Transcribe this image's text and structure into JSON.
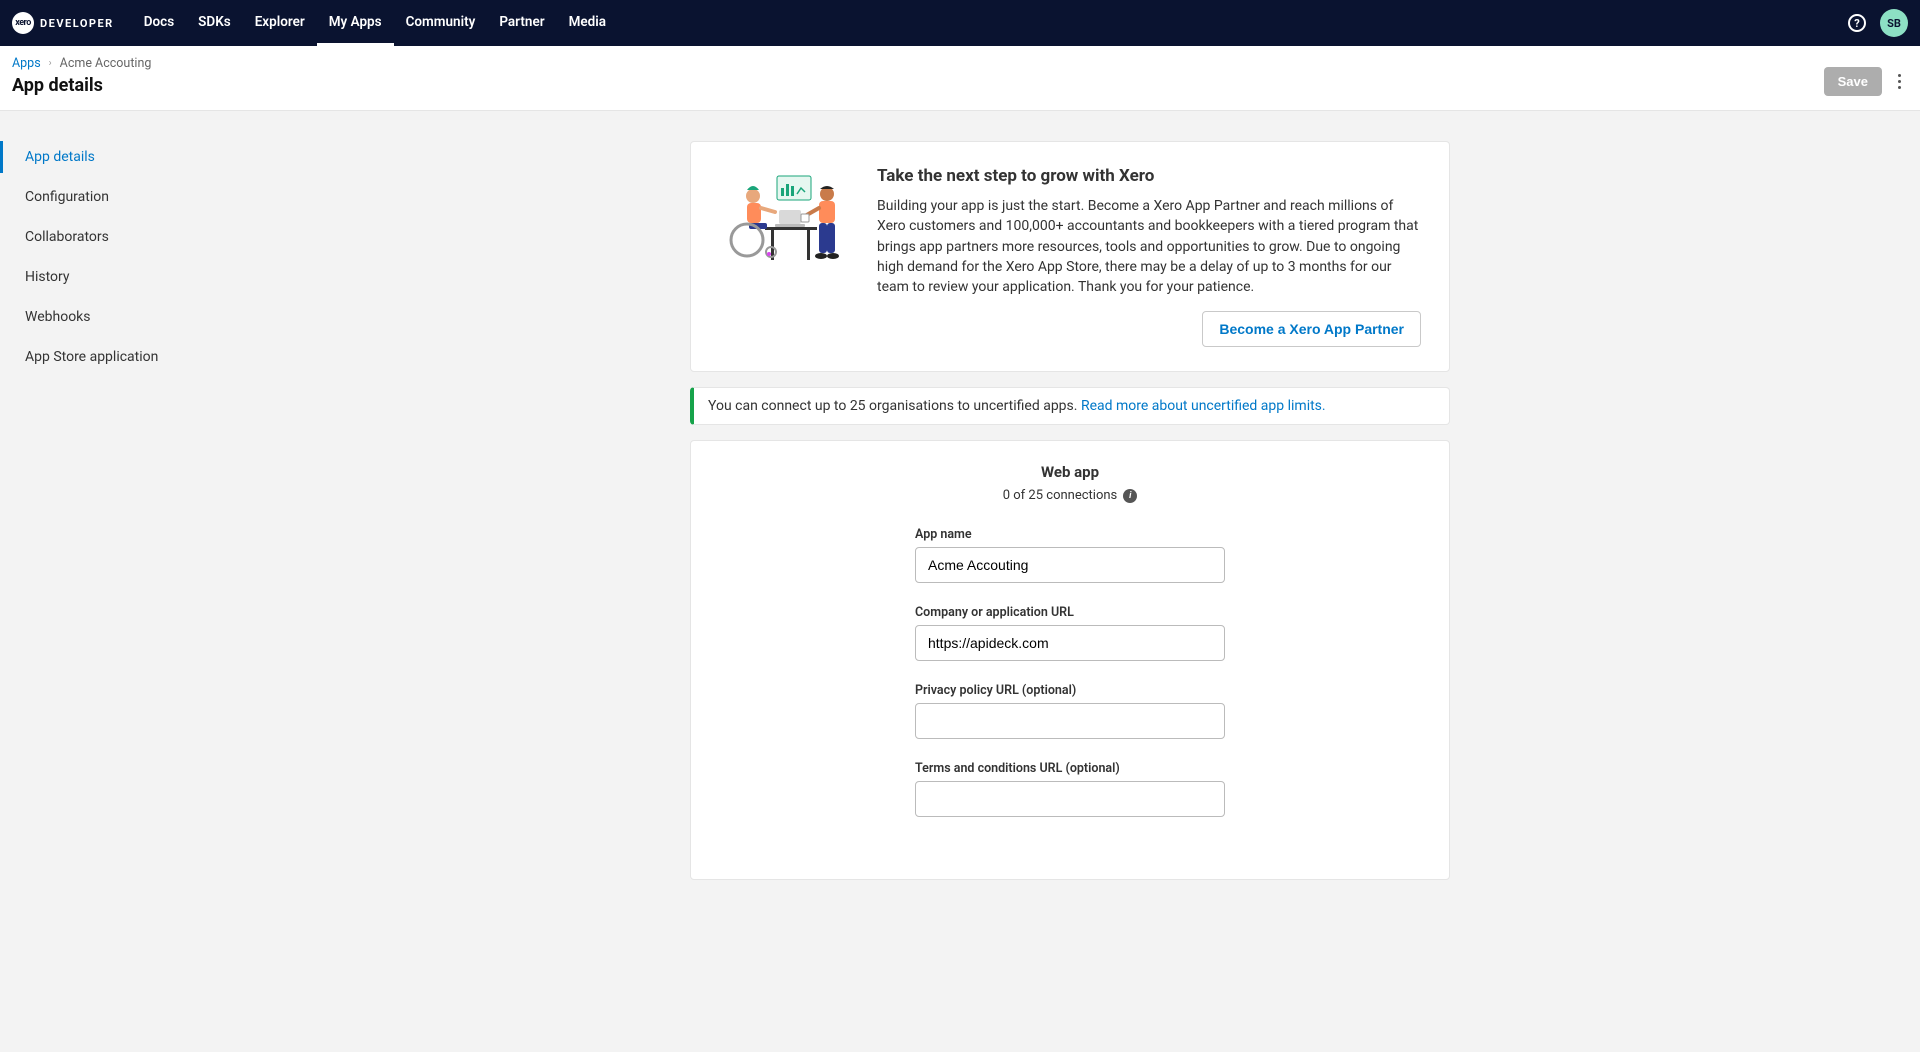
{
  "brand": {
    "logo_badge": "xero",
    "logo_text": "DEVELOPER"
  },
  "nav": {
    "items": [
      "Docs",
      "SDKs",
      "Explorer",
      "My Apps",
      "Community",
      "Partner",
      "Media"
    ],
    "active_index": 3
  },
  "user": {
    "initials": "SB"
  },
  "breadcrumb": {
    "root": "Apps",
    "current": "Acme Accouting"
  },
  "page_title": "App details",
  "actions": {
    "save_label": "Save"
  },
  "sidebar": {
    "items": [
      "App details",
      "Configuration",
      "Collaborators",
      "History",
      "Webhooks",
      "App Store application"
    ],
    "active_index": 0
  },
  "partner": {
    "heading": "Take the next step to grow with Xero",
    "body": "Building your app is just the start. Become a Xero App Partner and reach millions of Xero customers and 100,000+ accountants and bookkeepers with a tiered program that brings app partners more resources, tools and opportunities to grow. Due to ongoing high demand for the Xero App Store, there may be a delay of up to 3 months for our team to review your application. Thank you for your patience.",
    "cta": "Become a Xero App Partner"
  },
  "info_bar": {
    "text": "You can connect up to 25 organisations to uncertified apps. ",
    "link": "Read more about uncertified app limits."
  },
  "form": {
    "type_heading": "Web app",
    "connections": "0 of 25 connections",
    "fields": {
      "app_name": {
        "label": "App name",
        "value": "Acme Accouting"
      },
      "company_url": {
        "label": "Company or application URL",
        "value": "https://apideck.com"
      },
      "privacy_url": {
        "label": "Privacy policy URL (optional)",
        "value": ""
      },
      "terms_url": {
        "label": "Terms and conditions URL (optional)",
        "value": ""
      }
    }
  }
}
